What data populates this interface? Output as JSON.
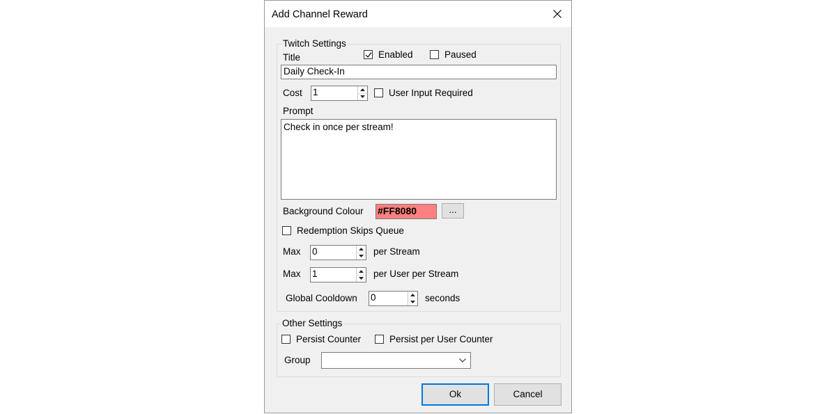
{
  "window": {
    "title": "Add Channel Reward"
  },
  "twitch_settings": {
    "group_title": "Twitch Settings",
    "title_label": "Title",
    "enabled_label": "Enabled",
    "enabled_checked": true,
    "paused_label": "Paused",
    "paused_checked": false,
    "title_value": "Daily Check-In",
    "cost_label": "Cost",
    "cost_value": "1",
    "user_input_label": "User Input Required",
    "user_input_checked": false,
    "prompt_label": "Prompt",
    "prompt_value": "Check in once per stream!",
    "bg_colour_label": "Background Colour",
    "bg_colour_value": "#FF8080",
    "browse_label": "...",
    "skips_queue_label": "Redemption Skips Queue",
    "skips_queue_checked": false,
    "max_label_1": "Max",
    "max_stream_value": "0",
    "per_stream_label": "per Stream",
    "max_label_2": "Max",
    "max_user_value": "1",
    "per_user_stream_label": "per User per Stream",
    "cooldown_label": "Global Cooldown",
    "cooldown_value": "0",
    "seconds_label": "seconds"
  },
  "other_settings": {
    "group_title": "Other Settings",
    "persist_counter_label": "Persist Counter",
    "persist_counter_checked": false,
    "persist_user_counter_label": "Persist per User Counter",
    "persist_user_counter_checked": false,
    "group_label": "Group",
    "group_value": ""
  },
  "buttons": {
    "ok_label": "Ok",
    "cancel_label": "Cancel"
  },
  "colors": {
    "accent": "#0078d7",
    "swatch": "#FF8080"
  }
}
